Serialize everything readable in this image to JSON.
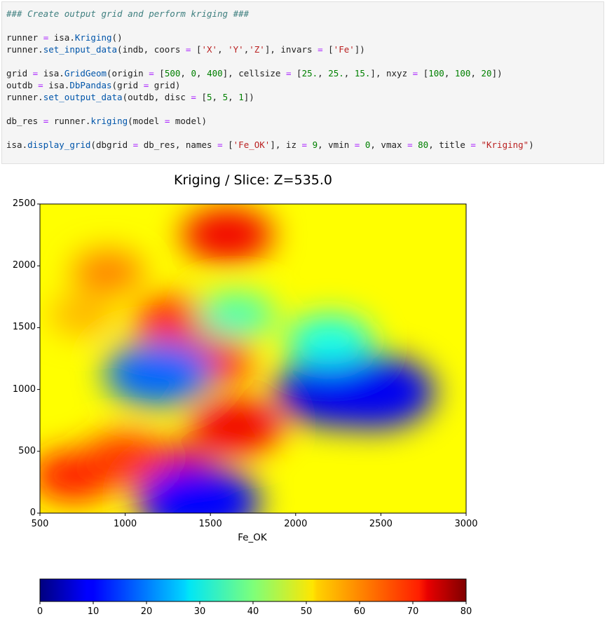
{
  "code_cell": {
    "comment": "### Create output grid and perform kriging ###",
    "lines": [
      [
        {
          "t": "runner ",
          "c": ""
        },
        {
          "t": "=",
          "c": "op"
        },
        {
          "t": " isa.",
          "c": ""
        },
        {
          "t": "Kriging",
          "c": "fn"
        },
        {
          "t": "()",
          "c": ""
        }
      ],
      [
        {
          "t": "runner.",
          "c": ""
        },
        {
          "t": "set_input_data",
          "c": "fn"
        },
        {
          "t": "(indb, coors ",
          "c": ""
        },
        {
          "t": "=",
          "c": "op"
        },
        {
          "t": " [",
          "c": ""
        },
        {
          "t": "'X'",
          "c": "str"
        },
        {
          "t": ", ",
          "c": ""
        },
        {
          "t": "'Y'",
          "c": "str"
        },
        {
          "t": ",",
          "c": ""
        },
        {
          "t": "'Z'",
          "c": "str"
        },
        {
          "t": "], invars ",
          "c": ""
        },
        {
          "t": "=",
          "c": "op"
        },
        {
          "t": " [",
          "c": ""
        },
        {
          "t": "'Fe'",
          "c": "str"
        },
        {
          "t": "])",
          "c": ""
        }
      ],
      [],
      [
        {
          "t": "grid ",
          "c": ""
        },
        {
          "t": "=",
          "c": "op"
        },
        {
          "t": " isa.",
          "c": ""
        },
        {
          "t": "GridGeom",
          "c": "fn"
        },
        {
          "t": "(origin ",
          "c": ""
        },
        {
          "t": "=",
          "c": "op"
        },
        {
          "t": " [",
          "c": ""
        },
        {
          "t": "500",
          "c": "num"
        },
        {
          "t": ", ",
          "c": ""
        },
        {
          "t": "0",
          "c": "num"
        },
        {
          "t": ", ",
          "c": ""
        },
        {
          "t": "400",
          "c": "num"
        },
        {
          "t": "], cellsize ",
          "c": ""
        },
        {
          "t": "=",
          "c": "op"
        },
        {
          "t": " [",
          "c": ""
        },
        {
          "t": "25.",
          "c": "num"
        },
        {
          "t": ", ",
          "c": ""
        },
        {
          "t": "25.",
          "c": "num"
        },
        {
          "t": ", ",
          "c": ""
        },
        {
          "t": "15.",
          "c": "num"
        },
        {
          "t": "], nxyz ",
          "c": ""
        },
        {
          "t": "=",
          "c": "op"
        },
        {
          "t": " [",
          "c": ""
        },
        {
          "t": "100",
          "c": "num"
        },
        {
          "t": ", ",
          "c": ""
        },
        {
          "t": "100",
          "c": "num"
        },
        {
          "t": ", ",
          "c": ""
        },
        {
          "t": "20",
          "c": "num"
        },
        {
          "t": "])",
          "c": ""
        }
      ],
      [
        {
          "t": "outdb ",
          "c": ""
        },
        {
          "t": "=",
          "c": "op"
        },
        {
          "t": " isa.",
          "c": ""
        },
        {
          "t": "DbPandas",
          "c": "fn"
        },
        {
          "t": "(grid ",
          "c": ""
        },
        {
          "t": "=",
          "c": "op"
        },
        {
          "t": " grid)",
          "c": ""
        }
      ],
      [
        {
          "t": "runner.",
          "c": ""
        },
        {
          "t": "set_output_data",
          "c": "fn"
        },
        {
          "t": "(outdb, disc ",
          "c": ""
        },
        {
          "t": "=",
          "c": "op"
        },
        {
          "t": " [",
          "c": ""
        },
        {
          "t": "5",
          "c": "num"
        },
        {
          "t": ", ",
          "c": ""
        },
        {
          "t": "5",
          "c": "num"
        },
        {
          "t": ", ",
          "c": ""
        },
        {
          "t": "1",
          "c": "num"
        },
        {
          "t": "])",
          "c": ""
        }
      ],
      [],
      [
        {
          "t": "db_res ",
          "c": ""
        },
        {
          "t": "=",
          "c": "op"
        },
        {
          "t": " runner.",
          "c": ""
        },
        {
          "t": "kriging",
          "c": "fn"
        },
        {
          "t": "(model ",
          "c": ""
        },
        {
          "t": "=",
          "c": "op"
        },
        {
          "t": " model)",
          "c": ""
        }
      ],
      [],
      [
        {
          "t": "isa.",
          "c": ""
        },
        {
          "t": "display_grid",
          "c": "fn"
        },
        {
          "t": "(dbgrid ",
          "c": ""
        },
        {
          "t": "=",
          "c": "op"
        },
        {
          "t": " db_res, names ",
          "c": ""
        },
        {
          "t": "=",
          "c": "op"
        },
        {
          "t": " [",
          "c": ""
        },
        {
          "t": "'Fe_OK'",
          "c": "str"
        },
        {
          "t": "], iz ",
          "c": ""
        },
        {
          "t": "=",
          "c": "op"
        },
        {
          "t": " ",
          "c": ""
        },
        {
          "t": "9",
          "c": "num"
        },
        {
          "t": ", vmin ",
          "c": ""
        },
        {
          "t": "=",
          "c": "op"
        },
        {
          "t": " ",
          "c": ""
        },
        {
          "t": "0",
          "c": "num"
        },
        {
          "t": ", vmax ",
          "c": ""
        },
        {
          "t": "=",
          "c": "op"
        },
        {
          "t": " ",
          "c": ""
        },
        {
          "t": "80",
          "c": "num"
        },
        {
          "t": ", title ",
          "c": ""
        },
        {
          "t": "=",
          "c": "op"
        },
        {
          "t": " ",
          "c": ""
        },
        {
          "t": "\"Kriging\"",
          "c": "str"
        },
        {
          "t": ")",
          "c": ""
        }
      ]
    ]
  },
  "chart_data": {
    "type": "heatmap",
    "title": "Kriging / Slice: Z=535.0",
    "xlabel": "Fe_OK",
    "ylabel": "",
    "xlim": [
      500,
      3000
    ],
    "ylim": [
      0,
      2500
    ],
    "xticks": [
      "500",
      "1000",
      "1500",
      "2000",
      "2500",
      "3000"
    ],
    "yticks": [
      "0",
      "500",
      "1000",
      "1500",
      "2000",
      "2500"
    ],
    "colormap": "jet",
    "vmin": 0,
    "vmax": 80,
    "background_value": 50,
    "features": [
      {
        "x": 1250,
        "y": 350,
        "value": 72
      },
      {
        "x": 700,
        "y": 300,
        "value": 68
      },
      {
        "x": 1000,
        "y": 450,
        "value": 66
      },
      {
        "x": 1650,
        "y": 700,
        "value": 71
      },
      {
        "x": 1500,
        "y": 1250,
        "value": 68
      },
      {
        "x": 1300,
        "y": 1550,
        "value": 67
      },
      {
        "x": 1600,
        "y": 2250,
        "value": 71
      },
      {
        "x": 900,
        "y": 1950,
        "value": 60
      },
      {
        "x": 750,
        "y": 1600,
        "value": 56
      },
      {
        "x": 1200,
        "y": 1130,
        "value": 18
      },
      {
        "x": 1430,
        "y": 90,
        "value": 10
      },
      {
        "x": 2250,
        "y": 1000,
        "value": 8
      },
      {
        "x": 2450,
        "y": 980,
        "value": 9
      },
      {
        "x": 1650,
        "y": 1600,
        "value": 36
      },
      {
        "x": 2200,
        "y": 1400,
        "value": 32
      }
    ],
    "colorbar": {
      "ticks": [
        "0",
        "10",
        "20",
        "30",
        "40",
        "50",
        "60",
        "70",
        "80"
      ]
    }
  }
}
